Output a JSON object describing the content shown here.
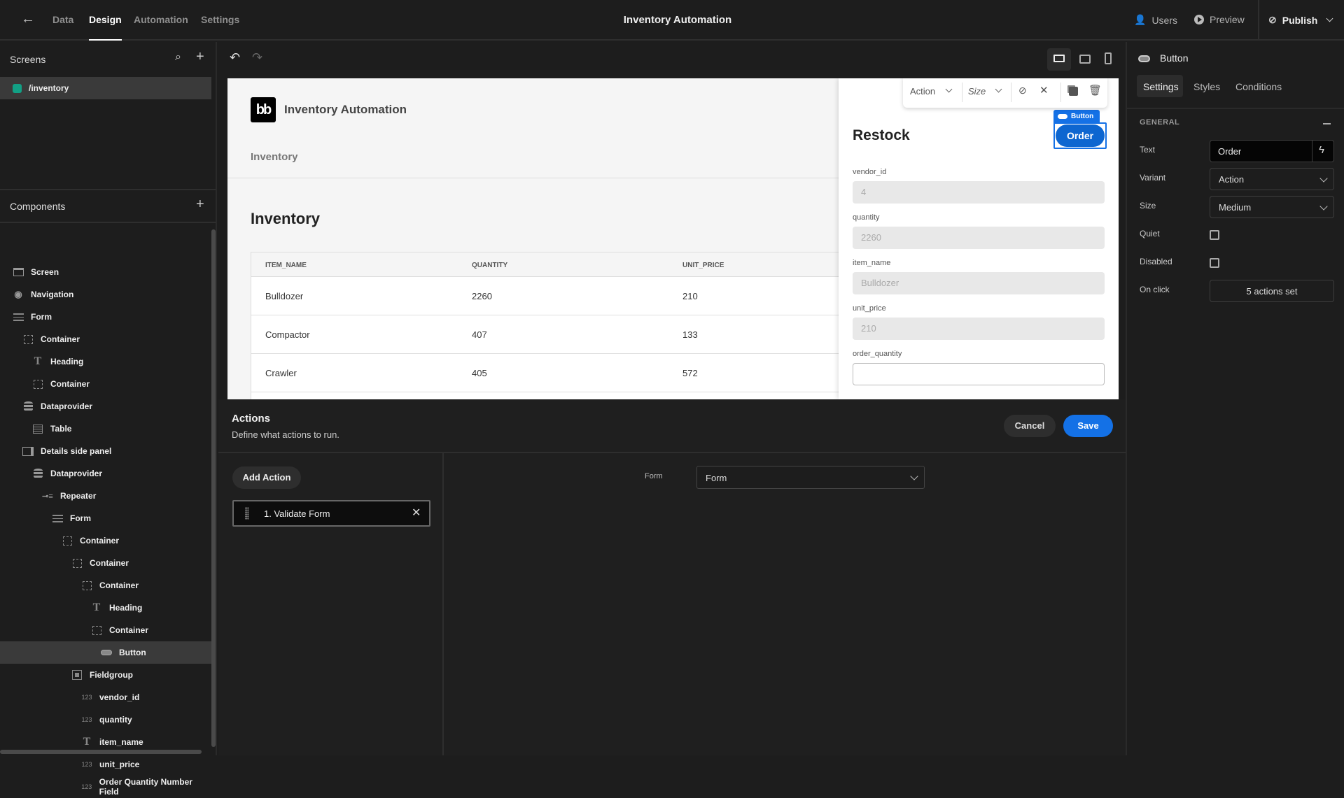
{
  "topbar": {
    "tabs": [
      {
        "label": "Data",
        "active": false
      },
      {
        "label": "Design",
        "active": true
      },
      {
        "label": "Automation",
        "active": false
      },
      {
        "label": "Settings",
        "active": false
      }
    ],
    "app_title": "Inventory Automation",
    "users_label": "Users",
    "preview_label": "Preview",
    "publish_label": "Publish"
  },
  "screens": {
    "title": "Screens",
    "items": [
      {
        "label": "/inventory",
        "color": "#12a085",
        "selected": true
      }
    ]
  },
  "components": {
    "title": "Components",
    "tree": [
      {
        "label": "Screen",
        "icon": "screen-icon",
        "depth": 0
      },
      {
        "label": "Navigation",
        "icon": "eye-icon",
        "depth": 0
      },
      {
        "label": "Form",
        "icon": "form-icon",
        "depth": 0
      },
      {
        "label": "Container",
        "icon": "container-icon",
        "depth": 1
      },
      {
        "label": "Heading",
        "icon": "text-icon",
        "depth": 2
      },
      {
        "label": "Container",
        "icon": "container-icon",
        "depth": 2
      },
      {
        "label": "Dataprovider",
        "icon": "database-icon",
        "depth": 1
      },
      {
        "label": "Table",
        "icon": "table-icon",
        "depth": 2
      },
      {
        "label": "Details side panel",
        "icon": "side-panel-icon",
        "depth": 1
      },
      {
        "label": "Dataprovider",
        "icon": "database-icon",
        "depth": 2
      },
      {
        "label": "Repeater",
        "icon": "repeater-icon",
        "depth": 3
      },
      {
        "label": "Form",
        "icon": "form-icon",
        "depth": 4
      },
      {
        "label": "Container",
        "icon": "container-icon",
        "depth": 5
      },
      {
        "label": "Container",
        "icon": "container-icon",
        "depth": 6
      },
      {
        "label": "Container",
        "icon": "container-icon",
        "depth": 7
      },
      {
        "label": "Heading",
        "icon": "text-icon",
        "depth": 8
      },
      {
        "label": "Container",
        "icon": "container-icon",
        "depth": 8
      },
      {
        "label": "Button",
        "icon": "button-icon",
        "depth": 9,
        "selected": true
      },
      {
        "label": "Fieldgroup",
        "icon": "fieldgroup-icon",
        "depth": 6
      },
      {
        "label": "vendor_id",
        "icon": "number-icon",
        "depth": 7
      },
      {
        "label": "quantity",
        "icon": "number-icon",
        "depth": 7
      },
      {
        "label": "item_name",
        "icon": "text-icon",
        "depth": 7
      },
      {
        "label": "unit_price",
        "icon": "number-icon",
        "depth": 7
      },
      {
        "label": "Order Quantity Number Field",
        "icon": "number-icon",
        "depth": 7
      }
    ]
  },
  "preview": {
    "app_name": "Inventory Automation",
    "logo_text": "bb",
    "nav_link": "Inventory",
    "page_heading": "Inventory",
    "table": {
      "columns": [
        "ITEM_NAME",
        "QUANTITY",
        "UNIT_PRICE"
      ],
      "rows": [
        [
          "Bulldozer",
          "2260",
          "210"
        ],
        [
          "Compactor",
          "407",
          "133"
        ],
        [
          "Crawler",
          "405",
          "572"
        ]
      ]
    },
    "side_panel": {
      "heading": "Restock",
      "button_label": "Order",
      "button_tag": "Button",
      "fields": [
        {
          "label": "vendor_id",
          "value": "4",
          "disabled": true
        },
        {
          "label": "quantity",
          "value": "2260",
          "disabled": true
        },
        {
          "label": "item_name",
          "value": "Bulldozer",
          "disabled": true
        },
        {
          "label": "unit_price",
          "value": "210",
          "disabled": true
        },
        {
          "label": "order_quantity",
          "value": "",
          "disabled": false
        }
      ]
    },
    "floating_toolbar": {
      "action_label": "Action",
      "size_label": "Size"
    }
  },
  "actions_panel": {
    "title": "Actions",
    "subtitle": "Define what actions to run.",
    "cancel_label": "Cancel",
    "save_label": "Save",
    "add_action_label": "Add Action",
    "actions": [
      {
        "label": "1. Validate Form"
      }
    ],
    "form_label": "Form",
    "form_value": "Form"
  },
  "settings_panel": {
    "component_name": "Button",
    "tabs": [
      {
        "label": "Settings",
        "active": true
      },
      {
        "label": "Styles",
        "active": false
      },
      {
        "label": "Conditions",
        "active": false
      }
    ],
    "section_title": "GENERAL",
    "text_label": "Text",
    "text_value": "Order",
    "variant_label": "Variant",
    "variant_value": "Action",
    "size_label": "Size",
    "size_value": "Medium",
    "quiet_label": "Quiet",
    "quiet_checked": false,
    "disabled_label": "Disabled",
    "disabled_checked": false,
    "onclick_label": "On click",
    "onclick_value": "5 actions set"
  },
  "colors": {
    "accent": "#1471e6",
    "screen_dot": "#12a085"
  }
}
